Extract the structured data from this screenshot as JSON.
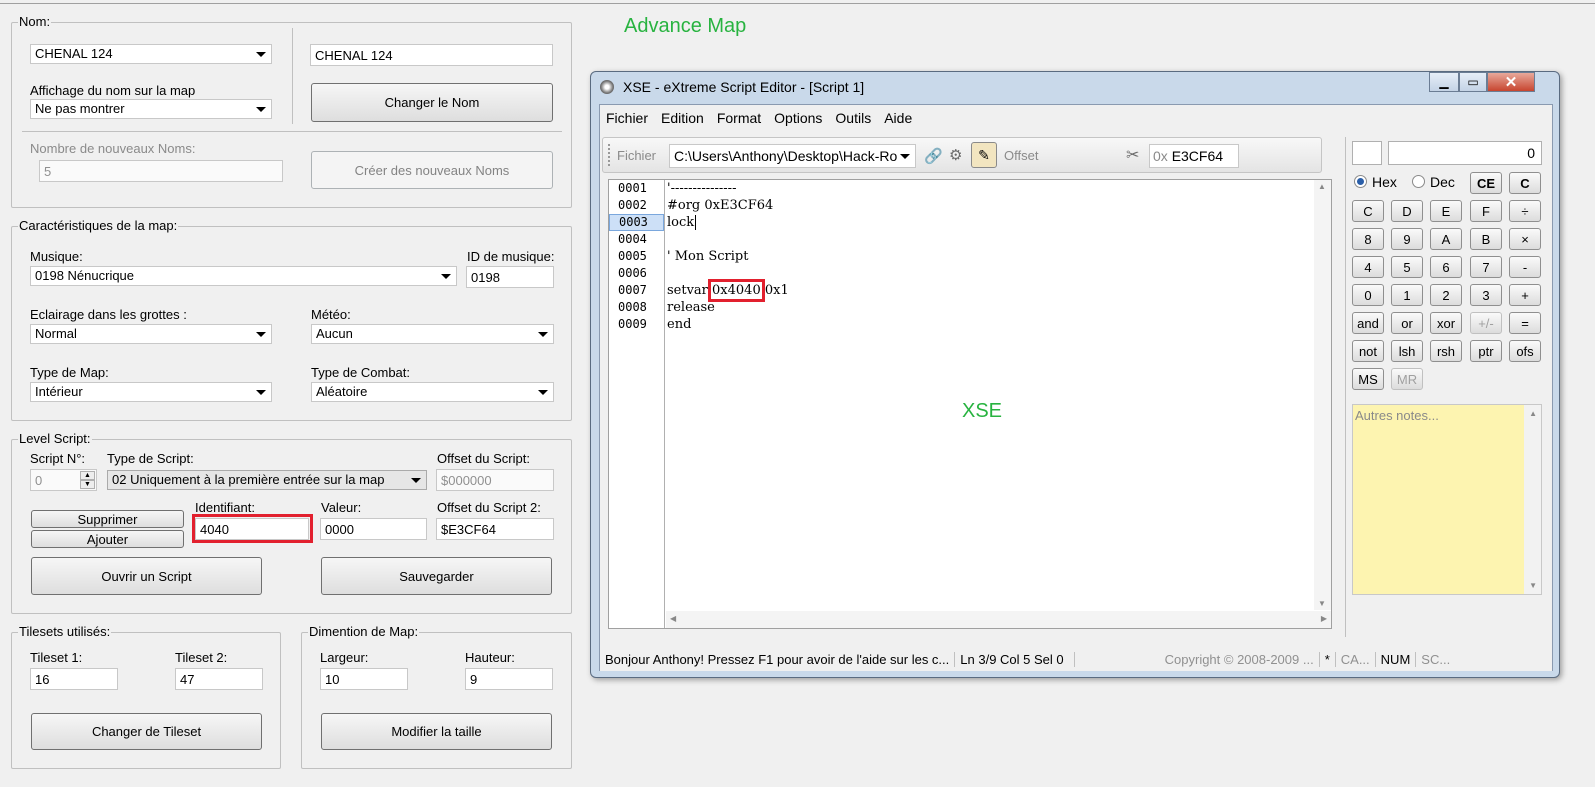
{
  "left_panel": {
    "nom": {
      "legend": "Nom:",
      "name_select": "CHENAL 124",
      "name_input": "CHENAL 124",
      "display_label": "Affichage du nom sur la map",
      "display_select": "Ne pas montrer",
      "change_name_button": "Changer le Nom",
      "count_label": "Nombre de nouveaux Noms:",
      "count_value": "5",
      "create_button": "Créer des nouveaux Noms"
    },
    "carac": {
      "legend": "Caractéristiques de la map:",
      "music_label": "Musique:",
      "music_select": "0198 Nénucrique",
      "music_id_label": "ID de musique:",
      "music_id_value": "0198",
      "light_label": "Eclairage dans les grottes :",
      "light_select": "Normal",
      "weather_label": "Météo:",
      "weather_select": "Aucun",
      "maptype_label": "Type de Map:",
      "maptype_select": "Intérieur",
      "combat_label": "Type de Combat:",
      "combat_select": "Aléatoire"
    },
    "level_script": {
      "legend": "Level Script:",
      "number_label": "Script N°:",
      "number_value": "0",
      "type_label": "Type de Script:",
      "type_select": "02 Uniquement à la première entrée sur la map",
      "offset_label": "Offset du Script:",
      "offset_value": "$000000",
      "delete_button": "Supprimer",
      "add_button": "Ajouter",
      "id_label": "Identifiant:",
      "id_value": "4040",
      "value_label": "Valeur:",
      "value_value": "0000",
      "offset2_label": "Offset du Script 2:",
      "offset2_value": "$E3CF64",
      "open_button": "Ouvrir un Script",
      "save_button": "Sauvegarder"
    },
    "tilesets": {
      "legend": "Tilesets utilisés:",
      "t1_label": "Tileset 1:",
      "t1_value": "16",
      "t2_label": "Tileset 2:",
      "t2_value": "47",
      "change_button": "Changer de Tileset"
    },
    "dimension": {
      "legend": "Dimention de Map:",
      "width_label": "Largeur:",
      "width_value": "10",
      "height_label": "Hauteur:",
      "height_value": "9",
      "resize_button": "Modifier la taille"
    }
  },
  "annotations": {
    "advance_map": "Advance Map",
    "xse": "XSE"
  },
  "xse": {
    "title": "XSE - eXtreme Script Editor - [Script 1]",
    "menu": [
      "Fichier",
      "Edition",
      "Format",
      "Options",
      "Outils",
      "Aide"
    ],
    "toolbar": {
      "file_label": "Fichier",
      "path": "C:\\Users\\Anthony\\Desktop\\Hack-Ro",
      "offset_label": "Offset",
      "hex_prefix": "0x",
      "offset_value": "E3CF64"
    },
    "line_numbers": [
      "0001",
      "0002",
      "0003",
      "0004",
      "0005",
      "0006",
      "0007",
      "0008",
      "0009"
    ],
    "code": {
      "l1": "'---------------",
      "l2": "#org 0xE3CF64",
      "l3": "lock",
      "l4": "",
      "l5": "' Mon Script",
      "l6": "",
      "l7a": "setvar ",
      "l7b": "0x4040",
      "l7c": " 0x1",
      "l8": "release",
      "l9": "end"
    },
    "status": {
      "message": "Bonjour Anthony! Pressez F1 pour avoir de l'aide sur les c...",
      "position": "Ln 3/9   Col 5   Sel 0",
      "copyright": "Copyright © 2008-2009 ...",
      "star": "*",
      "caps": "CA...",
      "num": "NUM",
      "scroll": "SC..."
    },
    "calc": {
      "display": "0",
      "hex_label": "Hex",
      "dec_label": "Dec",
      "ce": "CE",
      "c": "C",
      "keys": {
        "c2": "C",
        "d": "D",
        "e": "E",
        "f": "F",
        "div": "÷",
        "k8": "8",
        "k9": "9",
        "a": "A",
        "b": "B",
        "mul": "×",
        "k4": "4",
        "k5": "5",
        "k6": "6",
        "k7": "7",
        "sub": "-",
        "k0": "0",
        "k1": "1",
        "k2": "2",
        "k3": "3",
        "add": "+",
        "and": "and",
        "or": "or",
        "xor": "xor",
        "pm": "+/-",
        "eq": "=",
        "not": "not",
        "lsh": "lsh",
        "rsh": "rsh",
        "ptr": "ptr",
        "ofs": "ofs",
        "ms": "MS",
        "mr": "MR"
      },
      "notes_placeholder": "Autres notes..."
    }
  }
}
